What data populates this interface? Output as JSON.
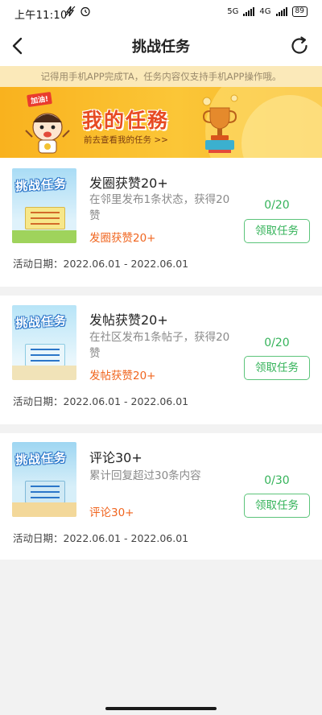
{
  "status_bar": {
    "time": "上午11:10",
    "net1": "5G",
    "net2": "4G",
    "battery": "89"
  },
  "navbar": {
    "title": "挑战任务"
  },
  "notice": "记得用手机APP完成TA，任务内容仅支持手机APP操作哦。",
  "banner": {
    "tag": "加油!",
    "title": "我的任務",
    "link": "前去查看我的任务 >>"
  },
  "tasks": [
    {
      "name": "发圈获赞20+",
      "desc": "在邻里发布1条状态，获得20赞",
      "reward": "发圈获赞20+",
      "progress": "0/20",
      "button": "领取任务",
      "date_label": "活动日期：",
      "dates": "2022.06.01 - 2022.06.01",
      "thumb_title": "挑战任务"
    },
    {
      "name": "发帖获赞20+",
      "desc": "在社区发布1条帖子，获得20赞",
      "reward": "发帖获赞20+",
      "progress": "0/20",
      "button": "领取任务",
      "date_label": "活动日期：",
      "dates": "2022.06.01 - 2022.06.01",
      "thumb_title": "挑战任务"
    },
    {
      "name": "评论30+",
      "desc": "累计回复超过30条内容",
      "reward": "评论30+",
      "progress": "0/30",
      "button": "领取任务",
      "date_label": "活动日期：",
      "dates": "2022.06.01 - 2022.06.01",
      "thumb_title": "挑战任务"
    }
  ],
  "colors": {
    "accent_green": "#35b35a",
    "reward_orange": "#f0651f",
    "banner_yellow": "#f9b21e",
    "notice_bg": "#fbe9b9"
  }
}
